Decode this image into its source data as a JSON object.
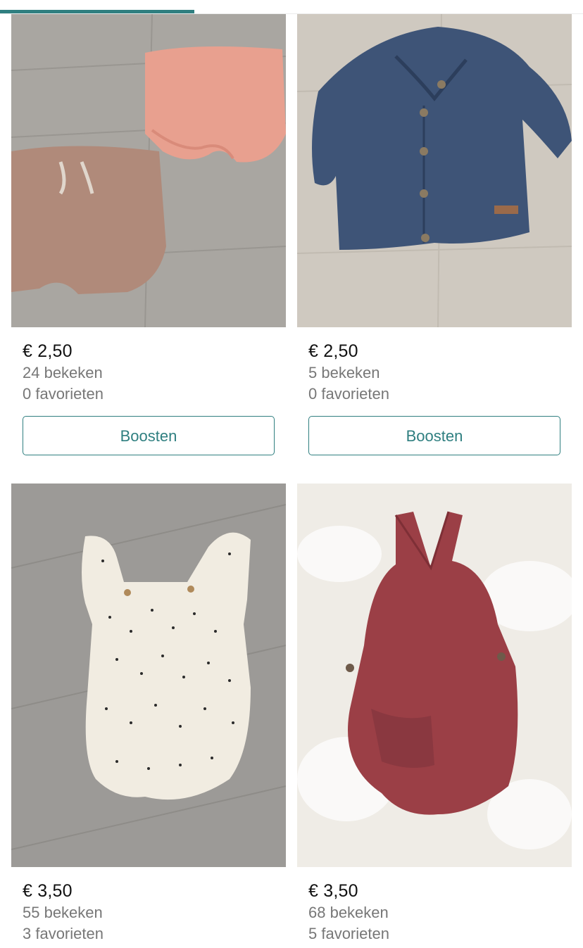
{
  "progress": {
    "fraction": 0.333,
    "color": "#2f7f80"
  },
  "items": [
    {
      "price": "€ 2,50",
      "views": "24 bekeken",
      "favorites": "0 favorieten",
      "button": "Boosten"
    },
    {
      "price": "€ 2,50",
      "views": "5 bekeken",
      "favorites": "0 favorieten",
      "button": "Boosten"
    },
    {
      "price": "€ 3,50",
      "views": "55 bekeken",
      "favorites": "3 favorieten"
    },
    {
      "price": "€ 3,50",
      "views": "68 bekeken",
      "favorites": "5 favorieten"
    }
  ],
  "colors": {
    "accent": "#2f7f80",
    "price": "#111111",
    "muted": "#777777"
  }
}
